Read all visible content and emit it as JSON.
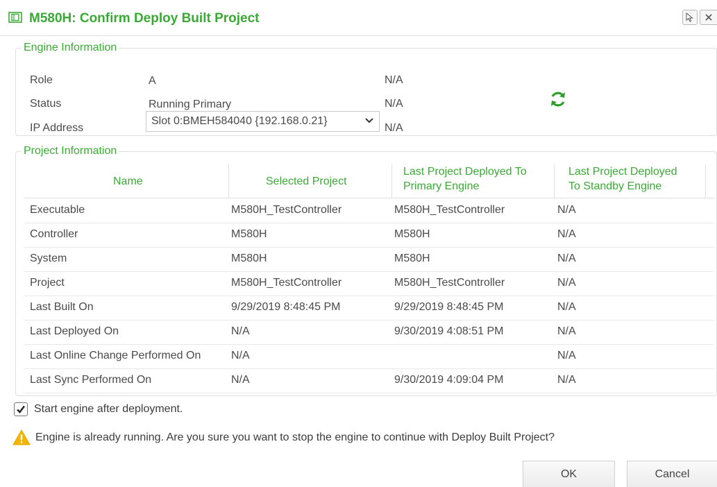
{
  "dialog": {
    "title": "M580H: Confirm Deploy Built Project"
  },
  "engine": {
    "legend": "Engine Information",
    "rows": [
      {
        "label": "Role",
        "value": "A",
        "na": "N/A"
      },
      {
        "label": "Status",
        "value": "Running Primary",
        "na": "N/A"
      },
      {
        "label": "IP Address",
        "value": "Slot 0:BMEH584040 {192.168.0.21}",
        "na": "N/A"
      }
    ]
  },
  "project": {
    "legend": "Project Information",
    "headers": {
      "name": "Name",
      "selected": "Selected Project",
      "primary_1": "Last Project Deployed To",
      "primary_2": "Primary Engine",
      "standby_1": "Last Project Deployed",
      "standby_2": "To Standby Engine"
    },
    "rows": [
      {
        "name": "Executable",
        "selected": "M580H_TestController",
        "primary": "M580H_TestController",
        "standby": "N/A"
      },
      {
        "name": "Controller",
        "selected": "M580H",
        "primary": "M580H",
        "standby": "N/A"
      },
      {
        "name": "System",
        "selected": "M580H",
        "primary": "M580H",
        "standby": "N/A"
      },
      {
        "name": "Project",
        "selected": "M580H_TestController",
        "primary": "M580H_TestController",
        "standby": "N/A"
      },
      {
        "name": "Last Built On",
        "selected": "9/29/2019 8:48:45 PM",
        "primary": "9/29/2019 8:48:45 PM",
        "standby": "N/A"
      },
      {
        "name": "Last Deployed On",
        "selected": "N/A",
        "primary": "9/30/2019 4:08:51 PM",
        "standby": "N/A"
      },
      {
        "name": "Last Online Change Performed On",
        "selected": "N/A",
        "primary": "",
        "standby": "N/A"
      },
      {
        "name": "Last Sync Performed On",
        "selected": "N/A",
        "primary": "9/30/2019 4:09:04 PM",
        "standby": "N/A"
      }
    ]
  },
  "options": {
    "start_engine_label": "Start engine after deployment.",
    "start_engine_checked": true
  },
  "warning": {
    "text": "Engine is already running. Are you sure you want to stop the engine to continue with Deploy Built Project?"
  },
  "buttons": {
    "ok": "OK",
    "cancel": "Cancel"
  },
  "colors": {
    "accent": "#3aaa35",
    "warning": "#f2b600"
  }
}
